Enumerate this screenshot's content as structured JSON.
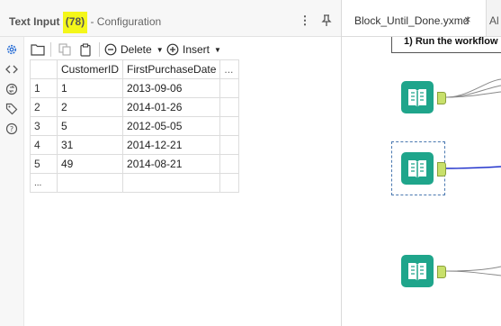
{
  "panel": {
    "title_prefix": "Text Input",
    "title_highlight": "(78)",
    "title_suffix": "- Configuration",
    "menu_icon": "⋮",
    "pin_icon": "⊥"
  },
  "side_icons": [
    "gear-icon",
    "code-icon",
    "swap-icon",
    "tag-icon",
    "help-icon"
  ],
  "toolbar": {
    "delete_label": "Delete",
    "insert_label": "Insert"
  },
  "grid": {
    "columns": [
      "CustomerID",
      "FirstPurchaseDate",
      "..."
    ],
    "rows": [
      {
        "num": "1",
        "customer_id": "1",
        "date": "2013-09-06"
      },
      {
        "num": "2",
        "customer_id": "2",
        "date": "2014-01-26"
      },
      {
        "num": "3",
        "customer_id": "5",
        "date": "2012-05-05"
      },
      {
        "num": "4",
        "customer_id": "31",
        "date": "2014-12-21"
      },
      {
        "num": "5",
        "customer_id": "49",
        "date": "2014-08-21"
      }
    ],
    "new_row_marker": "..."
  },
  "canvas": {
    "tab_label": "Block_Until_Done.yxmd",
    "tab_close": "×",
    "tab2_label": "Al",
    "comment": "1) Run the workflow"
  },
  "colors": {
    "highlight": "#f4f71a",
    "tool_teal": "#1fa58b",
    "anchor": "#c8e06b",
    "connector_blue": "#2233cc"
  }
}
